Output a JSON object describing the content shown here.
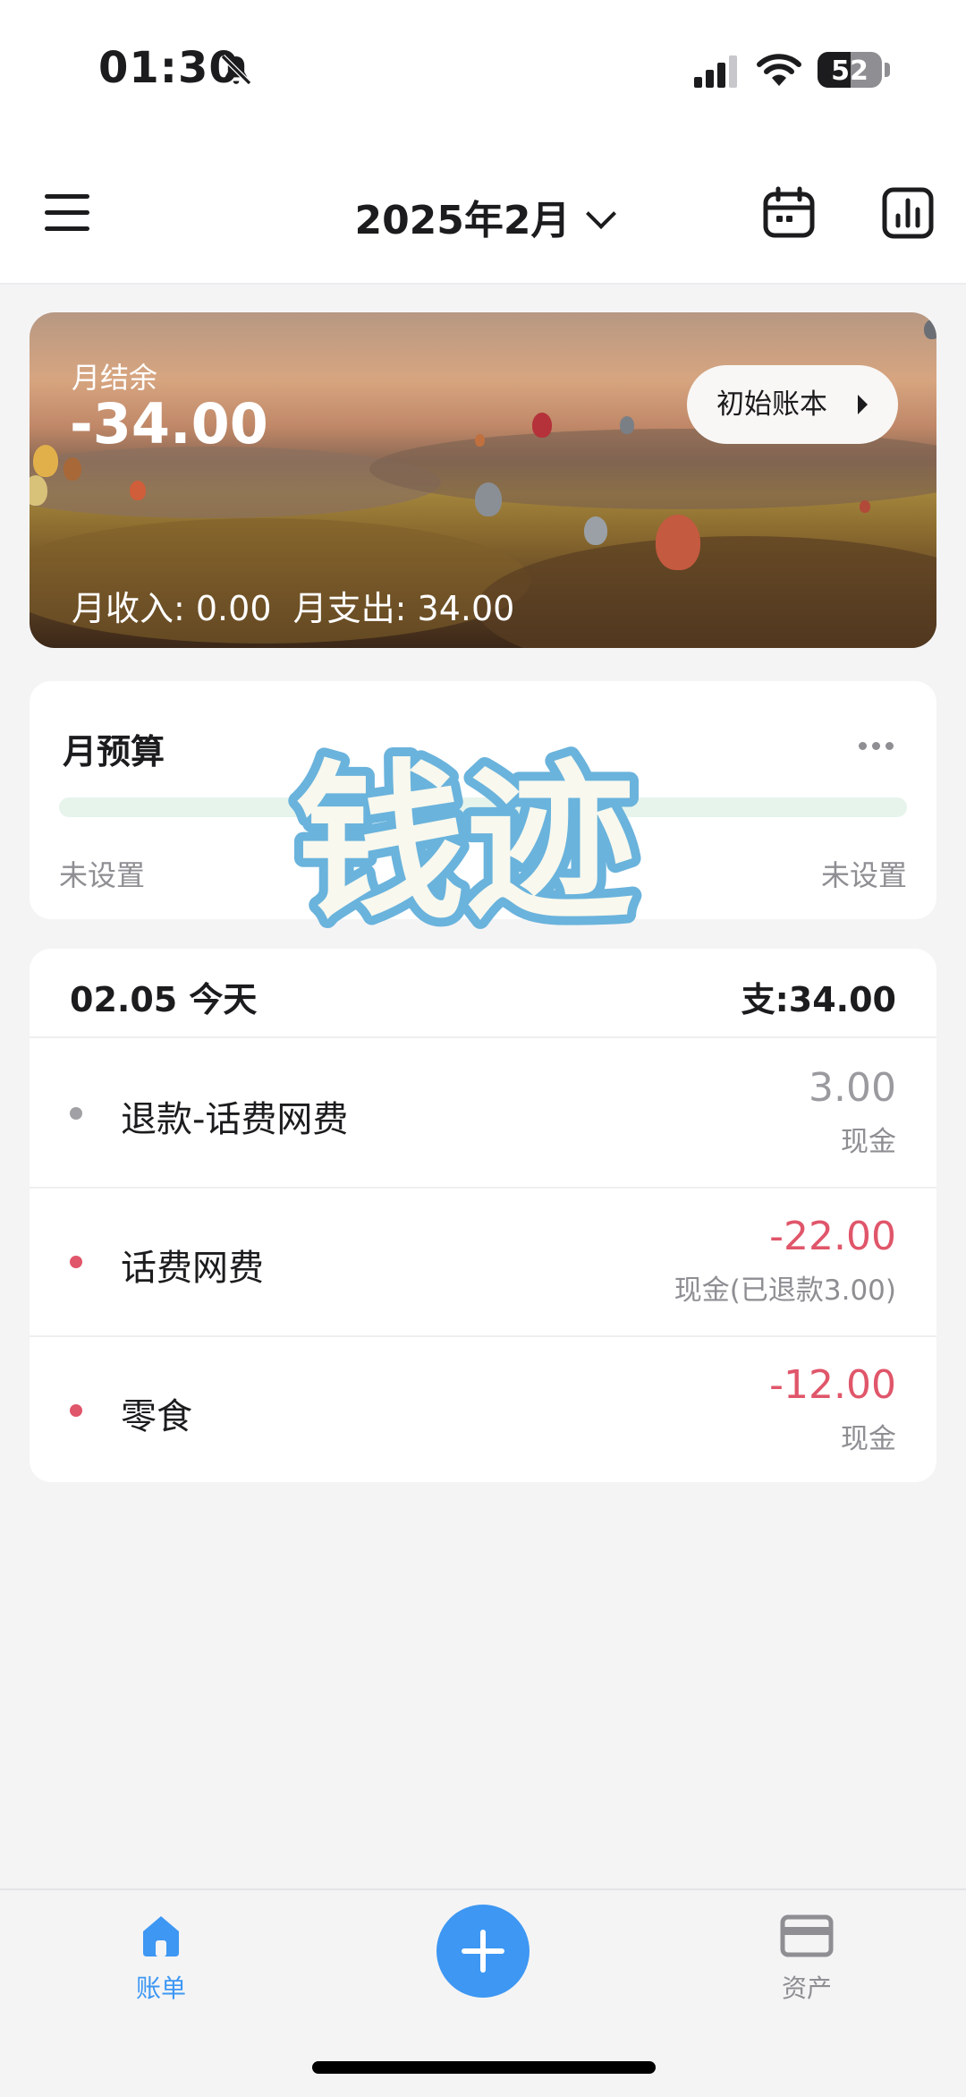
{
  "status_bar": {
    "time": "01:30",
    "battery_level": "52",
    "battery_fraction": 0.52
  },
  "header": {
    "title": "2025年2月"
  },
  "banner": {
    "balance_label": "月结余",
    "balance": "-34.00",
    "initial_book_label": "初始账本",
    "income_expense_summary": "月收入: 0.00  月支出: 34.00"
  },
  "budget": {
    "title": "月预算",
    "left_status": "未设置",
    "right_status": "未设置",
    "progress": 0
  },
  "watermark": {
    "text": "钱迹"
  },
  "day": {
    "date": "02.05 今天",
    "total": "支:34.00",
    "transactions": [
      {
        "name": "退款-话费网费",
        "amount": "3.00",
        "account": "现金",
        "dot_color": "#a0a0a5",
        "amount_color": "#9a9a9f"
      },
      {
        "name": "话费网费",
        "amount": "-22.00",
        "account": "现金(已退款3.00)",
        "dot_color": "#e0566a",
        "amount_color": "#e0566a"
      },
      {
        "name": "零食",
        "amount": "-12.00",
        "account": "现金",
        "dot_color": "#e0566a",
        "amount_color": "#e0566a"
      }
    ]
  },
  "tabbar": {
    "bills_label": "账单",
    "assets_label": "资产",
    "active_color": "#3d97f3",
    "inactive_color": "#8e8e93"
  }
}
